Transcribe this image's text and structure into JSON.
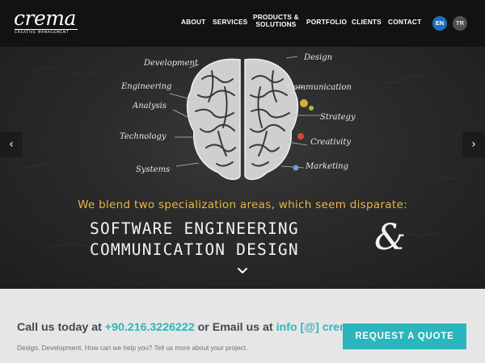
{
  "logo": {
    "wordmark": "crema",
    "subline": "CREATIVE MANAGEMENT"
  },
  "nav": {
    "items": [
      {
        "label": "ABOUT"
      },
      {
        "label": "SERVICES"
      },
      {
        "label_line1": "PRODUCTS &",
        "label_line2": "SOLUTIONS"
      },
      {
        "label": "PORTFOLIO"
      },
      {
        "label": "CLIENTS"
      },
      {
        "label": "CONTACT"
      }
    ],
    "languages": {
      "en": "EN",
      "tr": "TR"
    }
  },
  "hero": {
    "left_labels": [
      "Development",
      "Engineering",
      "Analysis",
      "Technology",
      "Systems"
    ],
    "right_labels": [
      "Design",
      "Communication",
      "Strategy",
      "Creativity",
      "Marketing"
    ],
    "tagline": "We blend two specialization areas, which seem disparate:",
    "headline_line1": "SOFTWARE ENGINEERING",
    "headline_line2": "COMMUNICATION DESIGN",
    "ampersand": "&",
    "prev_arrow": "‹",
    "next_arrow": "›",
    "icons": [
      "brain-illustration",
      "chevron-left-icon",
      "chevron-right-icon",
      "chevron-down-icon"
    ]
  },
  "cta": {
    "text_before_phone": "Call us today at ",
    "phone": "+90.216.3226222",
    "text_between": " or Email us at ",
    "email": "info [@] crem",
    "subtext": "Design. Development. How can we help you? Tell us more about your project.",
    "button_label": "REQUEST A QUOTE"
  },
  "colors": {
    "header_bg": "#121212",
    "accent_teal": "#2bb5bc",
    "tagline_gold": "#e9b741",
    "lang_active": "#1e6fbf",
    "chalk_bg": "#2a2a2a"
  }
}
